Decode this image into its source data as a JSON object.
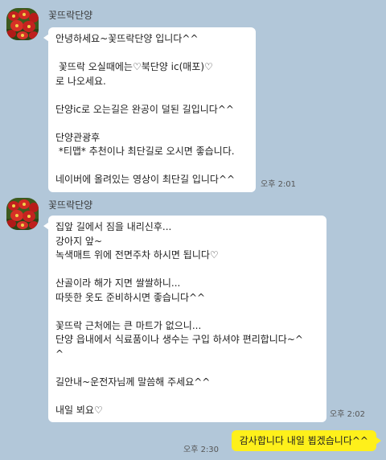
{
  "colors": {
    "background": "#b2c7d9",
    "received_bubble": "#ffffff",
    "sent_bubble": "#fef01b"
  },
  "messages": [
    {
      "sender": "꽃뜨락단양",
      "avatar_icon": "flower-avatar-icon",
      "time": "오후 2:01",
      "lines": [
        "안녕하세요~꽃뜨락단양 입니다^^",
        "",
        " 꽃뜨락 오실때에는♡북단양 ic(매포)♡",
        "로 나오세요.",
        "",
        "단양ic로 오는길은 완공이 덜된 길입니다^^",
        "",
        "단양관광후",
        " *티맵* 추천이나 최단길로 오시면 좋습니다.",
        "",
        "네이버에 올려있는 영상이 최단길 입니다^^"
      ]
    },
    {
      "sender": "꽃뜨락단양",
      "avatar_icon": "flower-avatar-icon",
      "time": "오후 2:02",
      "lines": [
        "집앞 길에서 짐을 내리신후...",
        "강아지 앞~",
        "녹색매트 위에 전면주차 하시면 됩니다♡",
        "",
        "산골이라 해가 지면 쌀쌀하니...",
        "따뜻한 옷도 준비하시면 좋습니다^^",
        "",
        "꽃뜨락 근처에는 큰 마트가 없으니...",
        "단양 읍내에서 식료품이나 생수는 구입 하셔야 편리합니다~^",
        "^",
        "",
        "길안내~운전자님께 말씀해 주세요^^",
        "",
        "내일 뵈요♡"
      ]
    }
  ],
  "my_message": {
    "time": "오후 2:30",
    "text": "감사합니다 내일 뵙겠습니다^^"
  }
}
